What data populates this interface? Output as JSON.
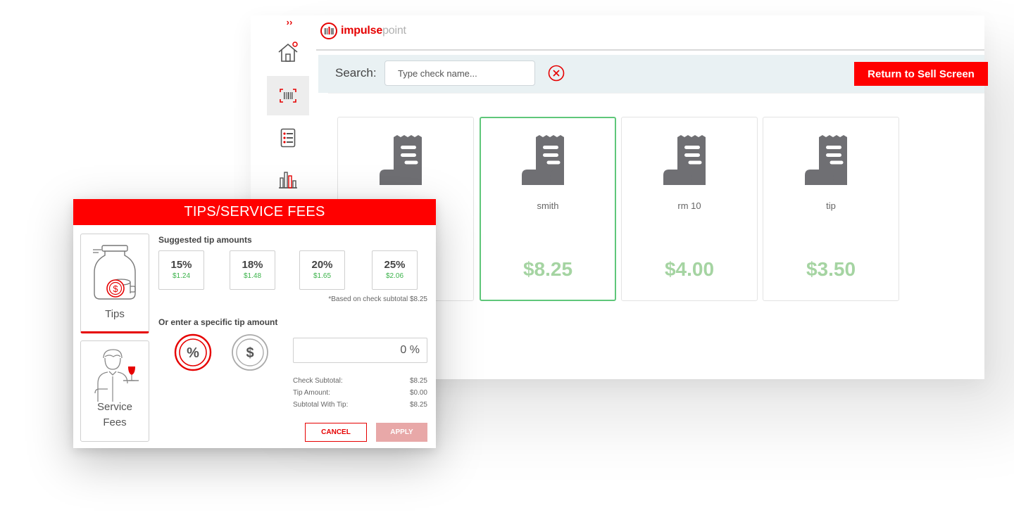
{
  "app": {
    "logo_bold": "impulse",
    "logo_light": "point",
    "rail_toggle": "››"
  },
  "search": {
    "label": "Search:",
    "placeholder": "Type check name..."
  },
  "return_button": "Return to Sell Screen",
  "checks": [
    {
      "name": "",
      "amount": ""
    },
    {
      "name": "smith",
      "amount": "$8.25"
    },
    {
      "name": "rm 10",
      "amount": "$4.00"
    },
    {
      "name": "tip",
      "amount": "$3.50"
    }
  ],
  "modal": {
    "title": "TIPS/SERVICE FEES",
    "tabs": {
      "tips": "Tips",
      "fees_line1": "Service",
      "fees_line2": "Fees"
    },
    "suggested_title": "Suggested tip amounts",
    "suggested": [
      {
        "pct": "15%",
        "amount": "$1.24"
      },
      {
        "pct": "18%",
        "amount": "$1.48"
      },
      {
        "pct": "20%",
        "amount": "$1.65"
      },
      {
        "pct": "25%",
        "amount": "$2.06"
      }
    ],
    "footnote": "*Based on check subtotal $8.25",
    "specific_title": "Or enter a specific tip amount",
    "percent_symbol": "%",
    "dollar_symbol": "$",
    "tip_value": "0 %",
    "summary": [
      {
        "label": "Check Subtotal:",
        "value": "$8.25"
      },
      {
        "label": "Tip Amount:",
        "value": "$0.00"
      },
      {
        "label": "Subtotal With Tip:",
        "value": "$8.25"
      }
    ],
    "cancel_label": "CANCEL",
    "apply_label": "APPLY"
  },
  "colors": {
    "brand_red": "#ff0000",
    "amount_green": "#a5d4a2",
    "selected_border": "#5fc77a",
    "apply_disabled": "#e8a8a8"
  }
}
